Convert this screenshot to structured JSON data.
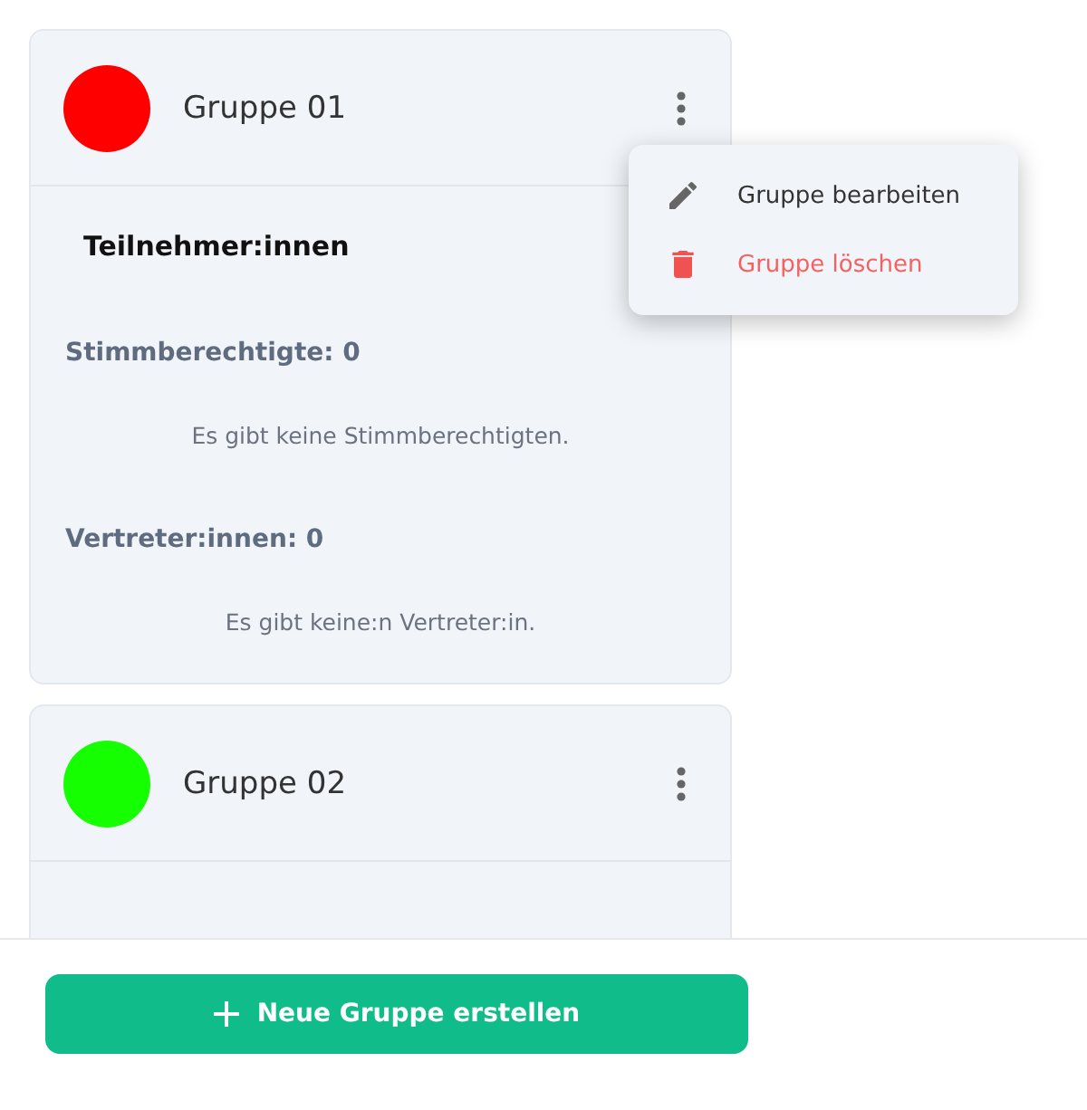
{
  "groups": [
    {
      "name": "Gruppe 01",
      "color": "#ff0000",
      "menu_open": true,
      "participants_heading": "Teilnehmer:innen",
      "sections": [
        {
          "title": "Stimmberechtigte: 0",
          "empty": "Es gibt keine Stimmberechtigten."
        },
        {
          "title": "Vertreter:innen: 0",
          "empty": "Es gibt keine:n Vertreter:in."
        }
      ]
    },
    {
      "name": "Gruppe 02",
      "color": "#15ff00",
      "menu_open": false
    }
  ],
  "menu": [
    {
      "kind": "edit",
      "label": "Gruppe bearbeiten"
    },
    {
      "kind": "delete",
      "label": "Gruppe löschen"
    }
  ],
  "create_button": {
    "label": "Neue Gruppe erstellen"
  }
}
